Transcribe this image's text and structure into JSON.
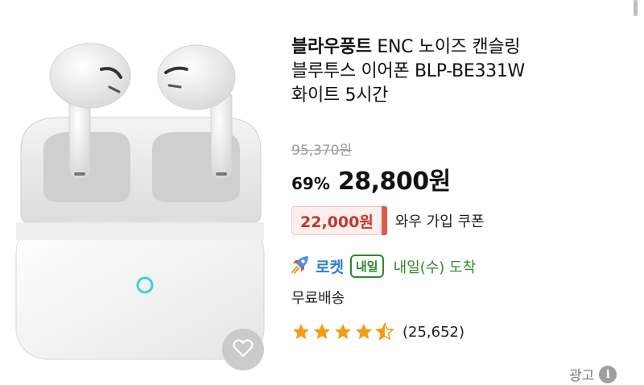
{
  "product": {
    "brand": "블라우풍트",
    "title_line1_rest": " ENC 노이즈 캔슬링",
    "title_line2": "블루투스 이어폰 BLP-BE331W",
    "title_line3": "화이트 5시간",
    "original_price": "95,370원",
    "discount_rate": "69%",
    "sale_price": "28,800원",
    "coupon": {
      "amount": "22,000원",
      "label": "와우 가입 쿠폰"
    },
    "delivery": {
      "rocket_icon": "rocket-icon",
      "rocket_label": "로켓",
      "badge": "내일",
      "arrival": "내일(수) 도착"
    },
    "shipping": "무료배송",
    "rating": {
      "value": 4.5,
      "max": 5,
      "reviews": "(25,652)"
    }
  },
  "ad": {
    "label": "광고",
    "icon": "info-icon",
    "icon_glyph": "i"
  },
  "colors": {
    "accent_blue": "#2f7cd6",
    "arrival_green": "#2e8a2e",
    "coupon_red": "#c0392b",
    "star": "#f39c12"
  }
}
